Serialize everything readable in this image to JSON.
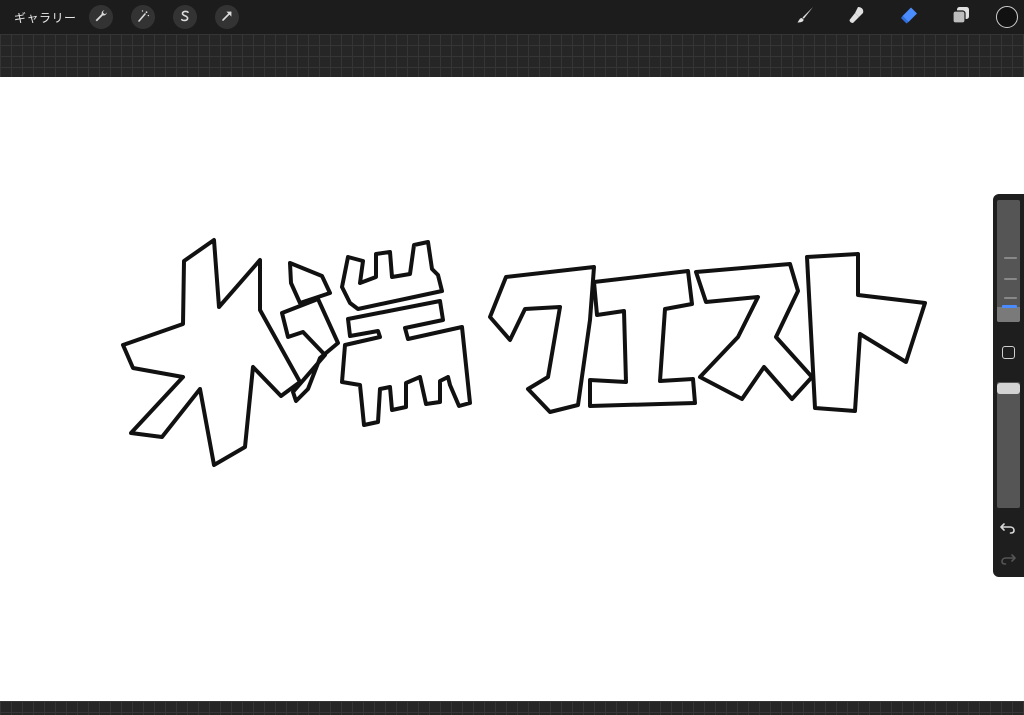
{
  "toolbar": {
    "gallery_label": "ギャラリー",
    "left_tools": [
      {
        "icon": "wrench-icon",
        "name": "actions"
      },
      {
        "icon": "magic-wand-icon",
        "name": "adjustments"
      },
      {
        "icon": "selection-s-icon",
        "name": "selection"
      },
      {
        "icon": "arrow-cursor-icon",
        "name": "transform"
      }
    ],
    "right_tools": [
      {
        "icon": "brush-icon",
        "name": "paint",
        "active": false
      },
      {
        "icon": "smudge-icon",
        "name": "smudge",
        "active": false
      },
      {
        "icon": "eraser-icon",
        "name": "erase",
        "active": true
      },
      {
        "icon": "layers-icon",
        "name": "layers",
        "active": false
      }
    ],
    "current_color": "#111111",
    "active_tool_color": "#4a8cff"
  },
  "canvas": {
    "artwork_text": "ホ端クエスト",
    "artwork_style": "outlined lettering, black stroke on white"
  },
  "sidebar": {
    "brush_size_level": 0.12,
    "brush_opacity_level": 0.95,
    "modify_button_icon": "square-icon",
    "undo_icon": "undo-icon",
    "redo_icon": "redo-icon",
    "redo_enabled": false
  }
}
